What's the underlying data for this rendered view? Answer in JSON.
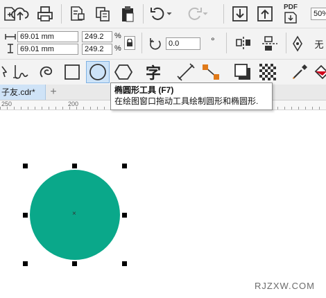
{
  "toolbar_standard": {
    "icons": [
      "import-icon",
      "cloud-icon",
      "print-icon",
      "doc-settings-icon",
      "copy-icon",
      "paste-icon",
      "undo-icon",
      "redo-icon",
      "export-down-icon",
      "export-up-icon",
      "pdf-icon"
    ],
    "pdf_label": "PDF",
    "zoom": "50%"
  },
  "property_bar": {
    "width": "69.01 mm",
    "height": "69.01 mm",
    "scale_x": "249.2",
    "scale_y": "249.2",
    "percent_x": "%",
    "percent_y": "%",
    "rotation": "0.0",
    "degree": "°",
    "wrap_label": "无"
  },
  "toolbox": {
    "icons": [
      "pick-tool-icon",
      "freehand-tool-icon",
      "spiral-tool-icon",
      "rectangle-tool-icon",
      "ellipse-tool-icon",
      "polygon-tool-icon",
      "text-tool-icon",
      "dimension-tool-icon",
      "connector-tool-icon",
      "drop-shadow-tool-icon",
      "transparency-tool-icon",
      "eyedropper-tool-icon",
      "fill-tool-icon"
    ],
    "text_glyph": "字"
  },
  "document_tab": {
    "name": "子友.cdr*",
    "add": "+"
  },
  "ruler": {
    "labels": [
      "250",
      "200"
    ]
  },
  "tooltip": {
    "title": "椭圆形工具 (F7)",
    "description": "在绘图窗口拖动工具绘制圆形和椭圆形."
  },
  "canvas": {
    "shape": "circle",
    "fill_color": "#0aa88a",
    "center_mark": "×"
  },
  "watermark": "RJZXW.COM"
}
